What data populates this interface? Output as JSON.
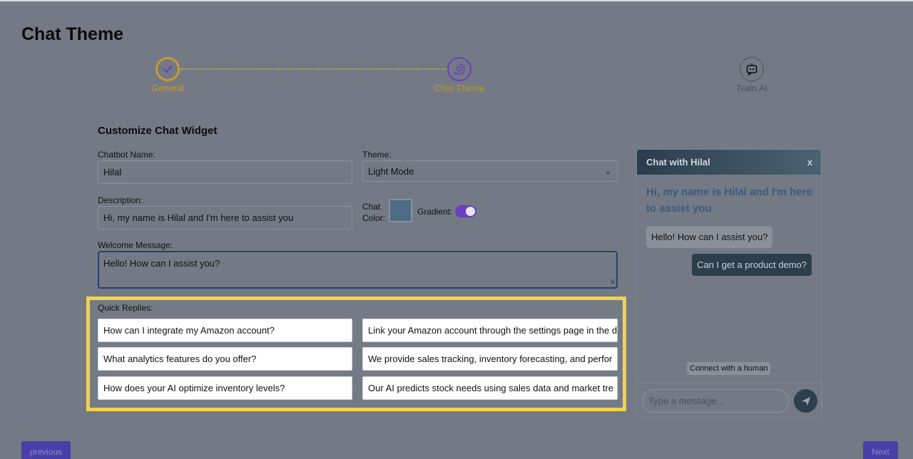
{
  "page": {
    "title": "Chat Theme"
  },
  "stepper": {
    "steps": [
      {
        "label": "General",
        "state": "completed",
        "color": "#c89a2f"
      },
      {
        "label": "Chat Theme",
        "state": "active",
        "color": "#b9962f"
      },
      {
        "label": "Train AI",
        "state": "pending",
        "color": "#4b525c"
      }
    ]
  },
  "form": {
    "section_title": "Customize Chat Widget",
    "chatbot_name": {
      "label": "Chatbot Name:",
      "value": "Hilal"
    },
    "theme": {
      "label": "Theme:",
      "value": "Light Mode"
    },
    "description": {
      "label": "Description:",
      "value": "Hi, my name is Hilal and I'm here to assist you"
    },
    "chat_color": {
      "label_line1": "Chat",
      "label_line2": "Color:",
      "value": "#4d6b85"
    },
    "gradient": {
      "label": "Gradient:",
      "enabled": true
    },
    "welcome_message": {
      "label": "Welcome Message:",
      "value": "Hello! How can I assist you?"
    }
  },
  "quick_replies": {
    "label": "Quick Replies:",
    "rows": [
      {
        "question": "How can I integrate my Amazon account?",
        "answer": "Link your Amazon account through the settings page in the d"
      },
      {
        "question": "What analytics features do you offer?",
        "answer": "We provide sales tracking, inventory forecasting, and perfor"
      },
      {
        "question": "How does your AI optimize inventory levels?",
        "answer": "Our AI predicts stock needs using sales data and market tre"
      }
    ]
  },
  "chat_preview": {
    "header_title": "Chat with Hilal",
    "close_label": "x",
    "welcome": "Hi, my name is Hilal and I'm here to assist you",
    "bot_message": "Hello! How can I assist you?",
    "user_message": "Can I get a product demo?",
    "connect_label": "Connect with a human",
    "input_placeholder": "Type a message..."
  },
  "navigation": {
    "previous_label": "previous",
    "next_label": "Next"
  },
  "colors": {
    "highlight": "#f4d24a",
    "accent": "#6a3fc4"
  }
}
